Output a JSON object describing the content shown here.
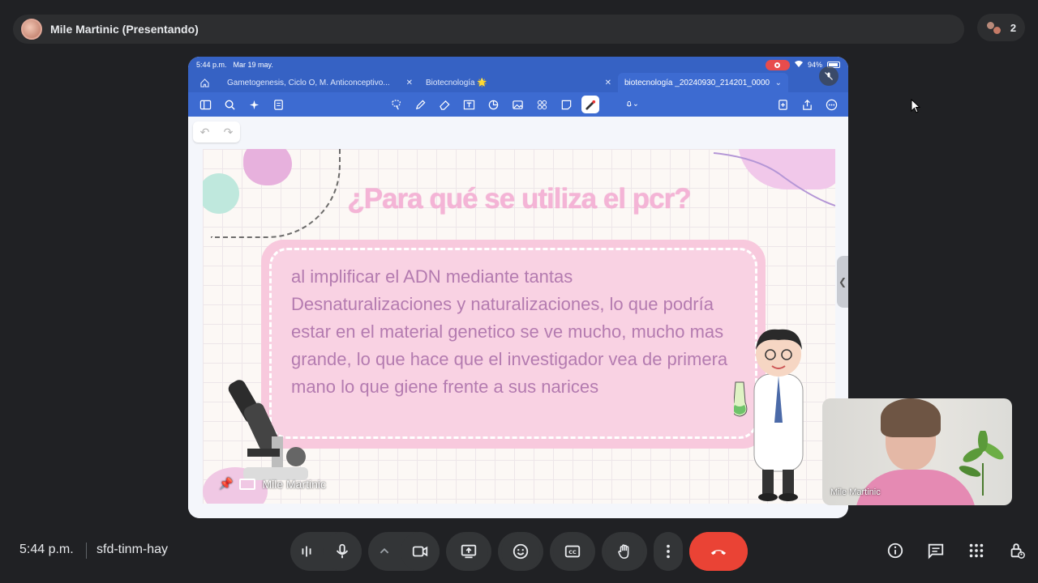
{
  "header": {
    "presenter_label": "Mile Martinic (Presentando)",
    "participant_count": "2"
  },
  "tablet": {
    "status_time": "5:44 p.m.",
    "status_date": "Mar 19 may.",
    "battery": "94%",
    "tabs": [
      {
        "label": "Gametogenesis, Ciclo O, M. Anticonceptivo..."
      },
      {
        "label": "Biotecnología 🌟"
      },
      {
        "label": "biotecnología _20240930_214201_0000"
      }
    ]
  },
  "slide": {
    "title": "¿Para qué se utiliza el pcr?",
    "body": "al implificar el ADN mediante tantas Desnaturalizaciones y naturalizaciones, lo que podría estar en el material genetico se ve mucho, mucho mas grande, lo que hace que el investigador vea de primera mano lo que giene frente a sus narices"
  },
  "share_label": "Mile Martinic",
  "self_view": {
    "name": "Mile Martinic"
  },
  "bottom": {
    "time": "5:44 p.m.",
    "meeting_code": "sfd-tinm-hay"
  },
  "colors": {
    "end_call": "#ea4335",
    "tablet_accent": "#3d6bd1",
    "slide_title": "#f4b4d6",
    "slide_text": "#b47bb0"
  }
}
